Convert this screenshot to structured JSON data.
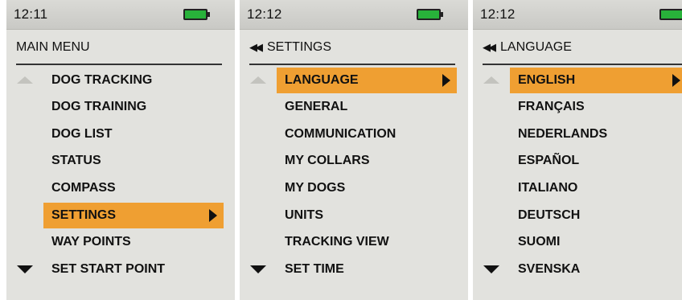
{
  "colors": {
    "highlight": "#ef9f32",
    "battery": "#28b23a",
    "screen_bg": "#e2e2de"
  },
  "screens": [
    {
      "time": "12:11",
      "title": "MAIN MENU",
      "has_back": false,
      "items": [
        "DOG TRACKING",
        "DOG TRAINING",
        "DOG LIST",
        "STATUS",
        "COMPASS",
        "SETTINGS",
        "WAY POINTS",
        "SET START POINT"
      ],
      "selected": 5
    },
    {
      "time": "12:12",
      "title": "SETTINGS",
      "has_back": true,
      "items": [
        "LANGUAGE",
        "GENERAL",
        "COMMUNICATION",
        "MY COLLARS",
        "MY DOGS",
        "UNITS",
        "TRACKING VIEW",
        "SET TIME"
      ],
      "selected": 0
    },
    {
      "time": "12:12",
      "title": "LANGUAGE",
      "has_back": true,
      "items": [
        "ENGLISH",
        "FRANÇAIS",
        "NEDERLANDS",
        "ESPAÑOL",
        "ITALIANO",
        "DEUTSCH",
        "SUOMI",
        "SVENSKA"
      ],
      "selected": 0
    }
  ],
  "icons": {
    "battery": "battery-full-icon",
    "back": "double-left-arrow-icon",
    "submenu": "right-arrow-icon",
    "scroll_up": "scroll-up-icon",
    "scroll_down": "scroll-down-icon"
  }
}
